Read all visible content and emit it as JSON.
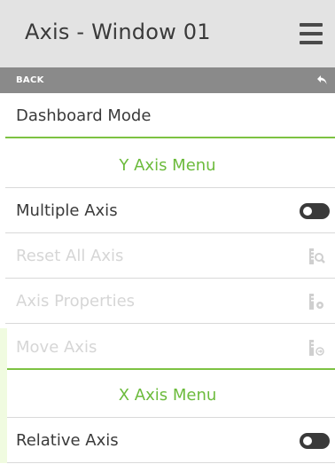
{
  "header": {
    "title": "Axis - Window 01",
    "menu_icon": "hamburger-menu-icon"
  },
  "backbar": {
    "label": "BACK",
    "icon": "back-arrow-icon"
  },
  "rows": [
    {
      "label": "Dashboard Mode"
    },
    {
      "label": "Y Axis Menu"
    },
    {
      "label": "Multiple Axis",
      "toggle": "off"
    },
    {
      "label": "Reset All Axis",
      "icon": "ruler-search-icon",
      "enabled": false
    },
    {
      "label": "Axis Properties",
      "icon": "ruler-gear-icon",
      "enabled": false
    },
    {
      "label": "Move Axis",
      "icon": "ruler-move-icon",
      "enabled": false
    },
    {
      "label": "X Axis Menu"
    },
    {
      "label": "Relative Axis",
      "toggle": "off"
    }
  ],
  "colors": {
    "accent_green": "#6cbb3c",
    "header_bg": "#e3e3e3",
    "backbar_bg": "#8a8a8a",
    "disabled_text": "#d6d6d6"
  }
}
